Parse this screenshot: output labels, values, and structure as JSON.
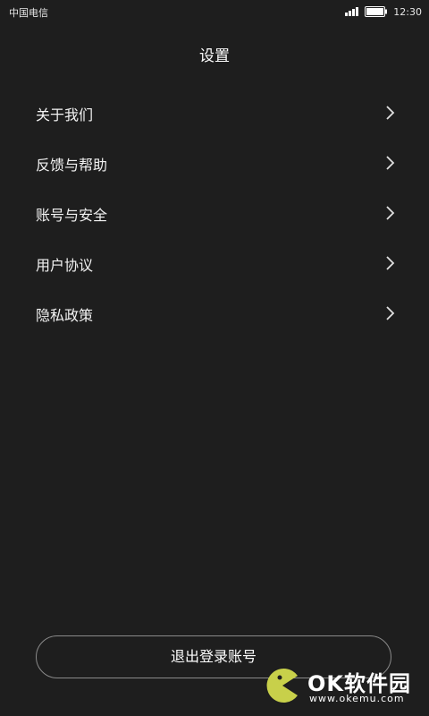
{
  "status_bar": {
    "carrier": "中国电信",
    "time": "12:30",
    "icons": [
      "signal-icon",
      "battery-icon"
    ]
  },
  "header": {
    "title": "设置"
  },
  "menu": {
    "items": [
      {
        "label": "关于我们",
        "icon": "chevron-right-icon"
      },
      {
        "label": "反馈与帮助",
        "icon": "chevron-right-icon"
      },
      {
        "label": "账号与安全",
        "icon": "chevron-right-icon"
      },
      {
        "label": "用户协议",
        "icon": "chevron-right-icon"
      },
      {
        "label": "隐私政策",
        "icon": "chevron-right-icon"
      }
    ]
  },
  "logout": {
    "label": "退出登录账号"
  },
  "watermark": {
    "brand": "OK软件园",
    "url": "www.okemu.com"
  },
  "colors": {
    "background": "#1e1e1e",
    "text": "#ffffff",
    "button_border": "#8a8a8a",
    "watermark_logo": "#c8d04a"
  }
}
